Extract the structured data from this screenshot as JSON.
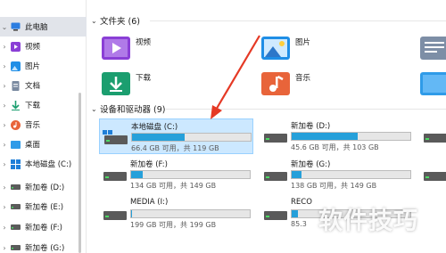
{
  "sidebar": {
    "items": [
      {
        "label": "此电脑",
        "icon": "pc-icon",
        "expander": "expanded"
      },
      {
        "label": "视频",
        "icon": "video-folder-icon",
        "expander": "collapsed"
      },
      {
        "label": "图片",
        "icon": "pictures-folder-icon",
        "expander": "collapsed"
      },
      {
        "label": "文档",
        "icon": "documents-folder-icon",
        "expander": "collapsed"
      },
      {
        "label": "下载",
        "icon": "download-arrow-icon",
        "expander": "collapsed"
      },
      {
        "label": "音乐",
        "icon": "music-icon",
        "expander": "collapsed"
      },
      {
        "label": "桌面",
        "icon": "desktop-folder-icon",
        "expander": "collapsed"
      },
      {
        "label": "本地磁盘 (C:)",
        "icon": "windows-drive-icon",
        "expander": "collapsed"
      },
      {
        "label": "新加卷 (D:)",
        "icon": "drive-icon",
        "expander": "collapsed"
      },
      {
        "label": "新加卷 (E:)",
        "icon": "drive-icon",
        "expander": "collapsed"
      },
      {
        "label": "新加卷 (F:)",
        "icon": "drive-icon",
        "expander": "collapsed"
      },
      {
        "label": "新加卷 (G:)",
        "icon": "drive-icon",
        "expander": "collapsed"
      }
    ]
  },
  "folders_section": {
    "title": "文件夹 (6)",
    "items": [
      {
        "label": "视频",
        "icon": "video-folder-icon"
      },
      {
        "label": "图片",
        "icon": "pictures-folder-icon"
      },
      {
        "label": "",
        "icon": "documents-folder-icon"
      },
      {
        "label": "下载",
        "icon": "downloads-folder-icon"
      },
      {
        "label": "音乐",
        "icon": "music-folder-icon"
      },
      {
        "label": "",
        "icon": "desktop-folder-icon"
      }
    ]
  },
  "drives_section": {
    "title": "设备和驱动器 (9)",
    "items": [
      {
        "name": "本地磁盘 (C:)",
        "info": "66.4 GB 可用，共 119 GB",
        "used_fraction": 0.44,
        "selected": true,
        "icon": "windows-drive-icon"
      },
      {
        "name": "新加卷 (D:)",
        "info": "45.6 GB 可用，共 103 GB",
        "used_fraction": 0.56,
        "selected": false,
        "icon": "drive-icon"
      },
      {
        "name": "",
        "info": "",
        "used_fraction": 0,
        "selected": false,
        "icon": "drive-icon"
      },
      {
        "name": "新加卷 (F:)",
        "info": "134 GB 可用，共 149 GB",
        "used_fraction": 0.1,
        "selected": false,
        "icon": "drive-icon"
      },
      {
        "name": "新加卷 (G:)",
        "info": "138 GB 可用，共 149 GB",
        "used_fraction": 0.08,
        "selected": false,
        "icon": "drive-icon"
      },
      {
        "name": "",
        "info": "",
        "used_fraction": 0,
        "selected": false,
        "icon": "drive-icon"
      },
      {
        "name": "MEDIA (I:)",
        "info": "199 GB 可用，共 199 GB",
        "used_fraction": 0.01,
        "selected": false,
        "icon": "drive-icon"
      },
      {
        "name": "RECO",
        "info": "85.3",
        "used_fraction": 0.05,
        "selected": false,
        "icon": "drive-icon"
      }
    ]
  },
  "watermark": "软件技巧",
  "colors": {
    "accent": "#26a0da",
    "selection": "#cce8ff",
    "arrow": "#e53925"
  }
}
